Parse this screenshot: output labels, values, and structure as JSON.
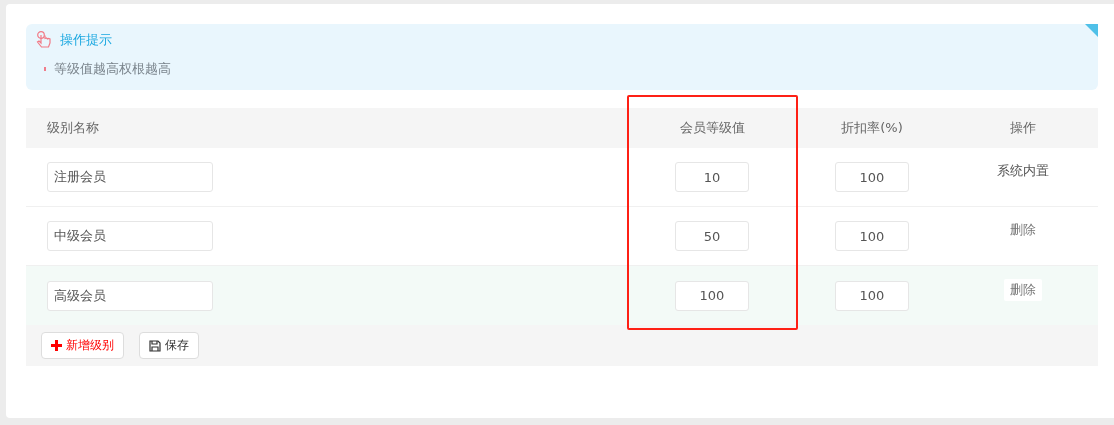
{
  "tips": {
    "title": "操作提示",
    "items": [
      "等级值越高权根越高"
    ]
  },
  "table": {
    "columns": [
      "级别名称",
      "会员等级值",
      "折扣率(%)",
      "操作"
    ],
    "rows": [
      {
        "name": "注册会员",
        "level_value": "10",
        "discount": "100",
        "action": {
          "kind": "text",
          "label": "系统内置"
        },
        "highlighted": false
      },
      {
        "name": "中级会员",
        "level_value": "50",
        "discount": "100",
        "action": {
          "kind": "link",
          "label": "删除"
        },
        "highlighted": false
      },
      {
        "name": "高级会员",
        "level_value": "100",
        "discount": "100",
        "action": {
          "kind": "link",
          "label": "删除"
        },
        "highlighted": true
      }
    ]
  },
  "buttons": [
    {
      "kind": "add",
      "label": "新增级别"
    },
    {
      "kind": "save",
      "label": "保存"
    }
  ]
}
